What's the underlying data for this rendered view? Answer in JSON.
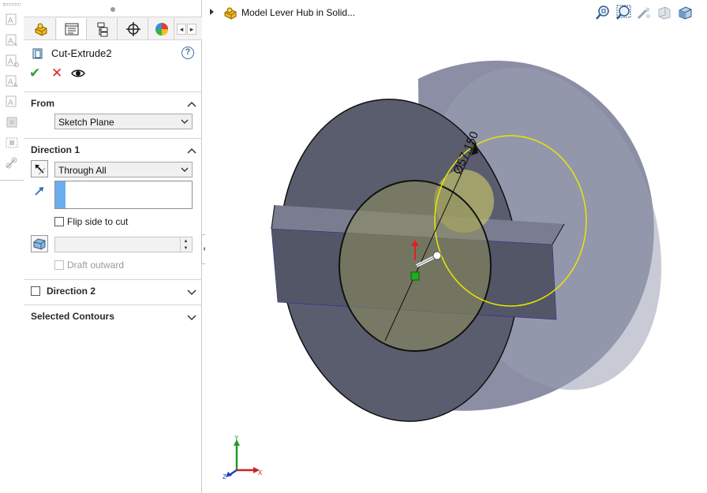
{
  "left_strip": {
    "icons": [
      "annotation-icon",
      "note-icon",
      "balloon-icon",
      "auto-balloon-icon",
      "surface-finish-icon",
      "weld-symbol-icon",
      "datum-icon",
      "geometric-tolerance-icon"
    ]
  },
  "tabs": {
    "items": [
      "feature-manager-tab",
      "property-manager-tab",
      "configuration-manager-tab",
      "dim-xpert-tab",
      "display-manager-tab"
    ],
    "scroll_left": "◂",
    "scroll_right": "▸"
  },
  "property_manager": {
    "title": "Cut-Extrude2",
    "help": "?",
    "ok": "✔",
    "cancel": "✕"
  },
  "from_group": {
    "title": "From",
    "value": "Sketch Plane"
  },
  "direction1": {
    "title": "Direction 1",
    "end_condition": "Through All",
    "flip_side_label": "Flip side to cut",
    "flip_side_checked": false,
    "draft_outward_label": "Draft outward",
    "draft_outward_checked": false
  },
  "direction2": {
    "title": "Direction 2",
    "checked": false
  },
  "selected_contours": {
    "title": "Selected Contours"
  },
  "viewport": {
    "tree_label": "Model Lever Hub in Solid...",
    "dimension_label": "Ø57.150",
    "view_tools": [
      "zoom-to-fit-icon",
      "zoom-to-area-icon",
      "previous-view-icon",
      "section-view-icon",
      "view-orientation-icon"
    ],
    "triad_axes": {
      "x": "X",
      "y": "Y",
      "z": "Z"
    },
    "colors": {
      "model_face": "#5a5d6e",
      "model_side": "#8b8ea4",
      "sketch_circle": "#e8e800",
      "preview_fill": "#bfbf6a"
    }
  }
}
